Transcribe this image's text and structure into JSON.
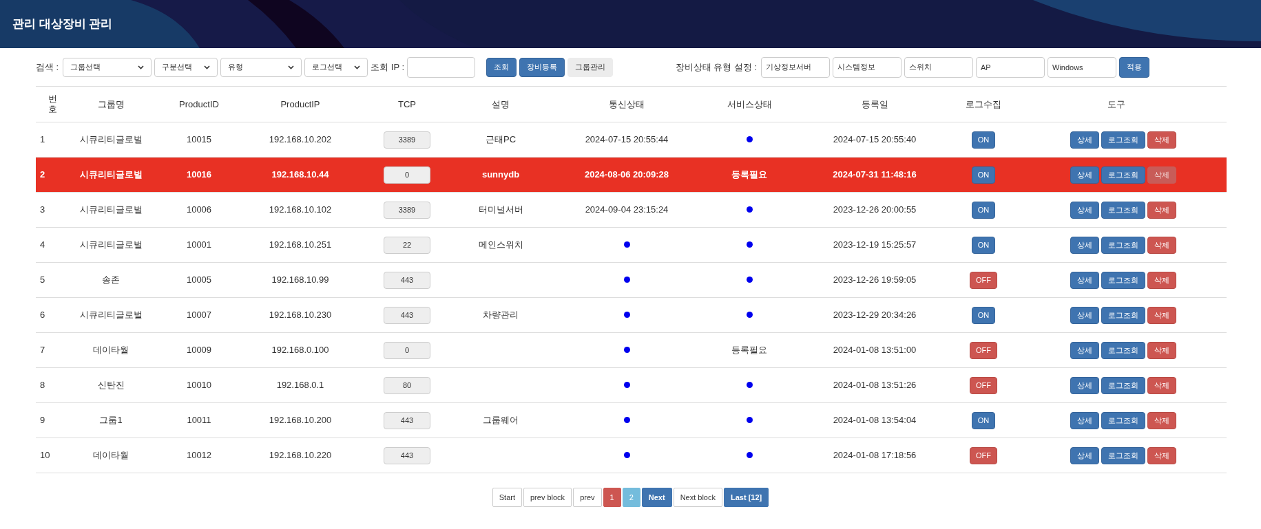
{
  "header": {
    "title": "관리 대상장비 관리"
  },
  "search": {
    "label": "검색 :",
    "selects": [
      {
        "value": "그룹선택"
      },
      {
        "value": "구분선택"
      },
      {
        "value": "유형"
      },
      {
        "value": "로그선택"
      }
    ],
    "ip_label": "조회 IP :",
    "buttons": [
      {
        "label": "조회",
        "kind": "primary"
      },
      {
        "label": "장비등록",
        "kind": "primary"
      },
      {
        "label": "그룹관리",
        "kind": "light"
      }
    ]
  },
  "status_types": {
    "label": "장비상태 유형 설정 :",
    "fields": [
      {
        "value": "기상정보서버"
      },
      {
        "value": "시스템정보"
      },
      {
        "value": "스위치"
      },
      {
        "value": "AP"
      },
      {
        "value": "Windows"
      }
    ],
    "apply": "적용"
  },
  "table": {
    "columns": [
      "번호",
      "그룹명",
      "ProductID",
      "ProductIP",
      "TCP",
      "설명",
      "통신상태",
      "서비스상태",
      "등록일",
      "로그수집",
      "도구"
    ],
    "rows": [
      {
        "no": "1",
        "group": "시큐리티글로벌",
        "pid": "10015",
        "ip": "192.168.10.202",
        "tcp": "3389",
        "desc": "근태PC",
        "comm": {
          "kind": "text",
          "text": "2024-07-15 20:55:44"
        },
        "service": {
          "kind": "dot"
        },
        "date": "2024-07-15 20:55:40",
        "log": {
          "label": "ON",
          "on": true
        },
        "alert": false,
        "tools": [
          {
            "label": "상세",
            "kind": "primary",
            "disabled": false
          },
          {
            "label": "로그조회",
            "kind": "primary",
            "disabled": false
          },
          {
            "label": "삭제",
            "kind": "danger",
            "disabled": false
          }
        ]
      },
      {
        "no": "2",
        "group": "시큐리티글로벌",
        "pid": "10016",
        "ip": "192.168.10.44",
        "tcp": "0",
        "desc": "sunnydb",
        "comm": {
          "kind": "text",
          "text": "2024-08-06 20:09:28"
        },
        "service": {
          "kind": "text",
          "text": "등록필요"
        },
        "date": "2024-07-31 11:48:16",
        "log": {
          "label": "ON",
          "on": true
        },
        "alert": true,
        "tools": [
          {
            "label": "상세",
            "kind": "primary",
            "disabled": false
          },
          {
            "label": "로그조회",
            "kind": "primary",
            "disabled": false
          },
          {
            "label": "삭제",
            "kind": "danger",
            "disabled": true
          }
        ]
      },
      {
        "no": "3",
        "group": "시큐리티글로벌",
        "pid": "10006",
        "ip": "192.168.10.102",
        "tcp": "3389",
        "desc": "터미널서버",
        "comm": {
          "kind": "text",
          "text": "2024-09-04 23:15:24"
        },
        "service": {
          "kind": "dot"
        },
        "date": "2023-12-26 20:00:55",
        "log": {
          "label": "ON",
          "on": true
        },
        "alert": false,
        "tools": [
          {
            "label": "상세",
            "kind": "primary",
            "disabled": false
          },
          {
            "label": "로그조회",
            "kind": "primary",
            "disabled": false
          },
          {
            "label": "삭제",
            "kind": "danger",
            "disabled": false
          }
        ]
      },
      {
        "no": "4",
        "group": "시큐리티글로벌",
        "pid": "10001",
        "ip": "192.168.10.251",
        "tcp": "22",
        "desc": "메인스위치",
        "comm": {
          "kind": "dot"
        },
        "service": {
          "kind": "dot"
        },
        "date": "2023-12-19 15:25:57",
        "log": {
          "label": "ON",
          "on": true
        },
        "alert": false,
        "tools": [
          {
            "label": "상세",
            "kind": "primary",
            "disabled": false
          },
          {
            "label": "로그조회",
            "kind": "primary",
            "disabled": false
          },
          {
            "label": "삭제",
            "kind": "danger",
            "disabled": false
          }
        ]
      },
      {
        "no": "5",
        "group": "송존",
        "pid": "10005",
        "ip": "192.168.10.99",
        "tcp": "443",
        "desc": "",
        "comm": {
          "kind": "dot"
        },
        "service": {
          "kind": "dot"
        },
        "date": "2023-12-26 19:59:05",
        "log": {
          "label": "OFF",
          "on": false
        },
        "alert": false,
        "tools": [
          {
            "label": "상세",
            "kind": "primary",
            "disabled": false
          },
          {
            "label": "로그조회",
            "kind": "primary",
            "disabled": false
          },
          {
            "label": "삭제",
            "kind": "danger",
            "disabled": false
          }
        ]
      },
      {
        "no": "6",
        "group": "시큐리티글로벌",
        "pid": "10007",
        "ip": "192.168.10.230",
        "tcp": "443",
        "desc": "차량관리",
        "comm": {
          "kind": "dot"
        },
        "service": {
          "kind": "dot"
        },
        "date": "2023-12-29 20:34:26",
        "log": {
          "label": "ON",
          "on": true
        },
        "alert": false,
        "tools": [
          {
            "label": "상세",
            "kind": "primary",
            "disabled": false
          },
          {
            "label": "로그조회",
            "kind": "primary",
            "disabled": false
          },
          {
            "label": "삭제",
            "kind": "danger",
            "disabled": false
          }
        ]
      },
      {
        "no": "7",
        "group": "데이타월",
        "pid": "10009",
        "ip": "192.168.0.100",
        "tcp": "0",
        "desc": "",
        "comm": {
          "kind": "dot"
        },
        "service": {
          "kind": "text",
          "text": "등록필요"
        },
        "date": "2024-01-08 13:51:00",
        "log": {
          "label": "OFF",
          "on": false
        },
        "alert": false,
        "tools": [
          {
            "label": "상세",
            "kind": "primary",
            "disabled": false
          },
          {
            "label": "로그조회",
            "kind": "primary",
            "disabled": false
          },
          {
            "label": "삭제",
            "kind": "danger",
            "disabled": false
          }
        ]
      },
      {
        "no": "8",
        "group": "신탄진",
        "pid": "10010",
        "ip": "192.168.0.1",
        "tcp": "80",
        "desc": "",
        "comm": {
          "kind": "dot"
        },
        "service": {
          "kind": "dot"
        },
        "date": "2024-01-08 13:51:26",
        "log": {
          "label": "OFF",
          "on": false
        },
        "alert": false,
        "tools": [
          {
            "label": "상세",
            "kind": "primary",
            "disabled": false
          },
          {
            "label": "로그조회",
            "kind": "primary",
            "disabled": false
          },
          {
            "label": "삭제",
            "kind": "danger",
            "disabled": false
          }
        ]
      },
      {
        "no": "9",
        "group": "그룹1",
        "pid": "10011",
        "ip": "192.168.10.200",
        "tcp": "443",
        "desc": "그룹웨어",
        "comm": {
          "kind": "dot"
        },
        "service": {
          "kind": "dot"
        },
        "date": "2024-01-08 13:54:04",
        "log": {
          "label": "ON",
          "on": true
        },
        "alert": false,
        "tools": [
          {
            "label": "상세",
            "kind": "primary",
            "disabled": false
          },
          {
            "label": "로그조회",
            "kind": "primary",
            "disabled": false
          },
          {
            "label": "삭제",
            "kind": "danger",
            "disabled": false
          }
        ]
      },
      {
        "no": "10",
        "group": "데이타월",
        "pid": "10012",
        "ip": "192.168.10.220",
        "tcp": "443",
        "desc": "",
        "comm": {
          "kind": "dot"
        },
        "service": {
          "kind": "dot"
        },
        "date": "2024-01-08 17:18:56",
        "log": {
          "label": "OFF",
          "on": false
        },
        "alert": false,
        "tools": [
          {
            "label": "상세",
            "kind": "primary",
            "disabled": false
          },
          {
            "label": "로그조회",
            "kind": "primary",
            "disabled": false
          },
          {
            "label": "삭제",
            "kind": "danger",
            "disabled": false
          }
        ]
      }
    ]
  },
  "pagination": [
    {
      "label": "Start",
      "kind": "link"
    },
    {
      "label": "prev block",
      "kind": "link"
    },
    {
      "label": "prev",
      "kind": "link"
    },
    {
      "label": "1",
      "kind": "current"
    },
    {
      "label": "2",
      "kind": "page"
    },
    {
      "label": "Next",
      "kind": "primary"
    },
    {
      "label": "Next block",
      "kind": "link"
    },
    {
      "label": "Last [12]",
      "kind": "primary"
    }
  ]
}
